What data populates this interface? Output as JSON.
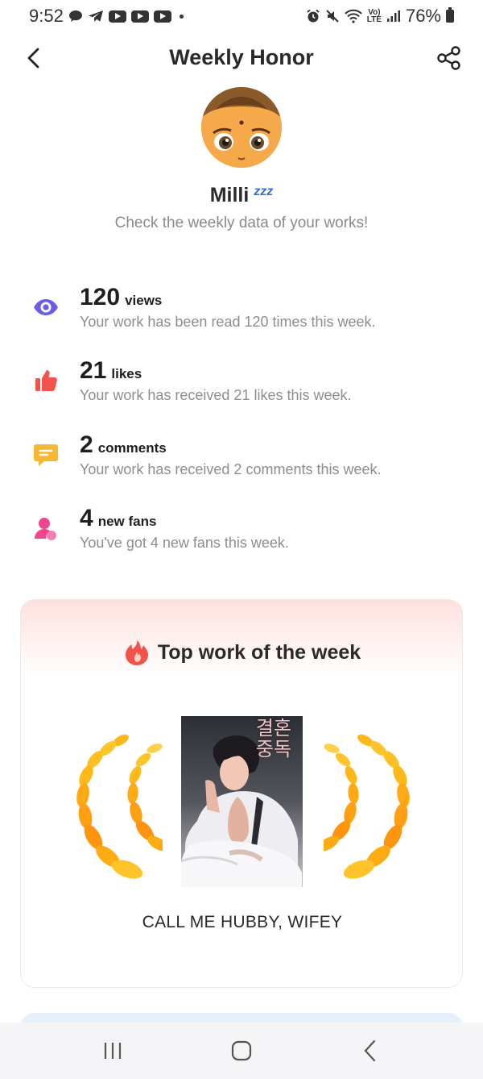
{
  "status_bar": {
    "time": "9:52",
    "battery": "76%",
    "icons": [
      "chat-bubble-icon",
      "telegram-icon",
      "youtube-icon",
      "youtube-icon",
      "youtube-icon",
      "alarm-icon",
      "mute-icon",
      "wifi-icon",
      "volte-icon",
      "signal-icon",
      "battery-icon"
    ]
  },
  "header": {
    "title": "Weekly Honor",
    "back_icon": "chevron-left-icon",
    "share_icon": "share-icon"
  },
  "profile": {
    "name": "Milli",
    "badge": "zzz",
    "subtitle": "Check the weekly data of your works!"
  },
  "stats": [
    {
      "icon": "eye-icon",
      "color": "#6b5ce7",
      "number": "120",
      "unit": "views",
      "description": "Your work has been read 120 times this week."
    },
    {
      "icon": "thumbs-up-icon",
      "color": "#f2544b",
      "number": "21",
      "unit": "likes",
      "description": "Your work has received 21 likes this week."
    },
    {
      "icon": "comment-icon",
      "color": "#f7b733",
      "number": "2",
      "unit": "comments",
      "description": "Your work has received 2 comments this week."
    },
    {
      "icon": "user-icon",
      "color": "#f0468c",
      "number": "4",
      "unit": "new fans",
      "description": "You've got 4 new fans this week."
    }
  ],
  "top_work": {
    "heading": "Top work of the week",
    "heading_icon": "fire-icon",
    "cover_text": "결혼중독",
    "work_title": "CALL ME HUBBY, WIFEY",
    "accent": "#f7a21b"
  },
  "nav_bar": {
    "recents_icon": "recents-icon",
    "home_icon": "home-icon",
    "back_icon": "back-icon"
  }
}
